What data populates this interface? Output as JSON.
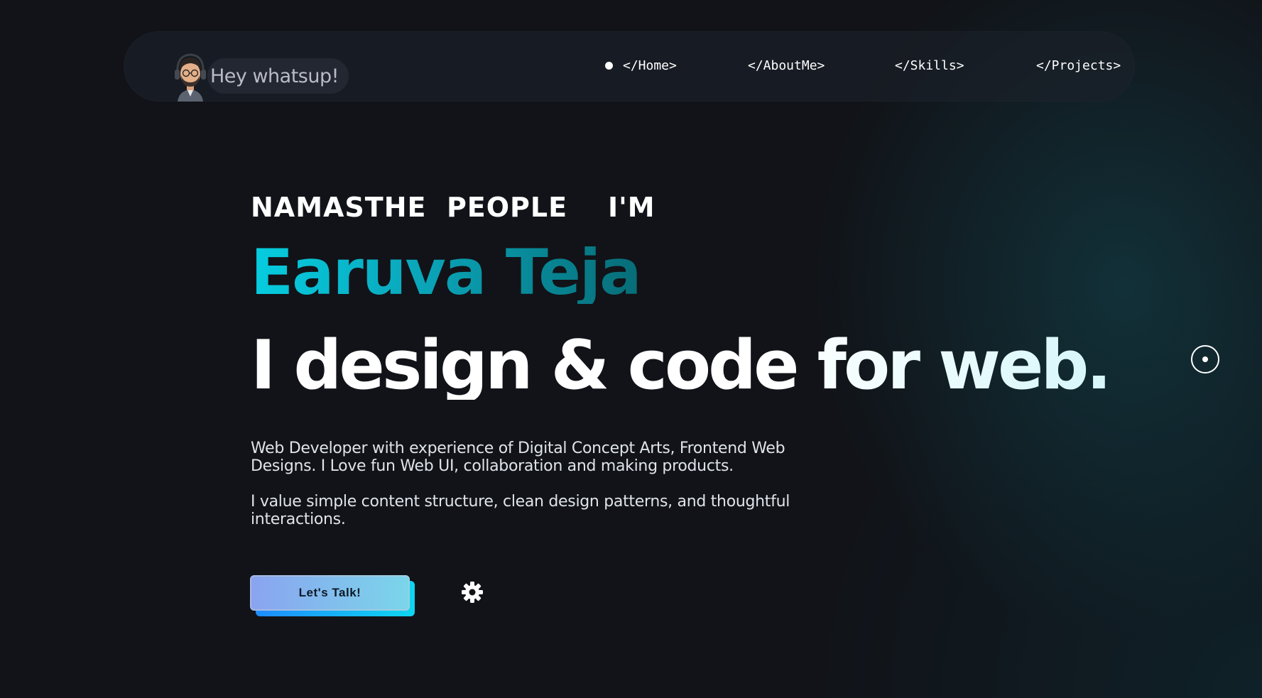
{
  "navbar": {
    "greeting": "Hey whatsup!",
    "avatar_icon": "avatar-memoji-icon",
    "links": [
      {
        "label": "</Home>",
        "active": true
      },
      {
        "label": "</AboutMe>",
        "active": false
      },
      {
        "label": "</Skills>",
        "active": false
      },
      {
        "label": "</Projects>",
        "active": false
      }
    ]
  },
  "hero": {
    "intro": "NAMASTHE  PEOPLE    I'M",
    "name": "Earuva Teja",
    "tagline": "I design & code for web.",
    "description_1": "Web Developer with experience of Digital Concept Arts, Frontend Web Designs. I Love fun Web UI, collaboration and making products.",
    "description_2": "I value simple content structure, clean design patterns, and thoughtful interactions.",
    "cta_label": "Let's Talk!",
    "settings_icon": "gear-icon"
  },
  "colors": {
    "background": "#111318",
    "name_gradient_start": "#06cde0",
    "name_gradient_end": "#076c77",
    "cta_gradient_start": "#8aa3f0",
    "cta_gradient_end": "#7ad6ea"
  }
}
